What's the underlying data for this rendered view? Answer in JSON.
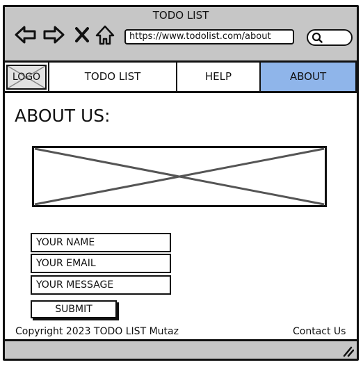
{
  "window": {
    "title": "TODO LIST"
  },
  "browser": {
    "url": "https://www.todolist.com/about",
    "icons": [
      "back-arrow-icon",
      "forward-arrow-icon",
      "close-icon",
      "home-icon",
      "search-icon"
    ]
  },
  "nav": {
    "logo_label": "LOGO",
    "items": [
      {
        "label": "TODO LIST",
        "active": false
      },
      {
        "label": "HELP",
        "active": false
      },
      {
        "label": "ABOUT",
        "active": true
      }
    ],
    "active_color": "#8fb5ea"
  },
  "main": {
    "heading": "ABOUT US:"
  },
  "form": {
    "name_value": "YOUR NAME",
    "email_value": "YOUR EMAIL",
    "message_value": "YOUR MESSAGE",
    "submit_label": "SUBMIT"
  },
  "footer": {
    "copyright": "Copyright 2023 TODO LIST Mutaz",
    "contact": "Contact Us"
  },
  "colors": {
    "chrome": "#c6c6c6",
    "outline": "#111111"
  }
}
